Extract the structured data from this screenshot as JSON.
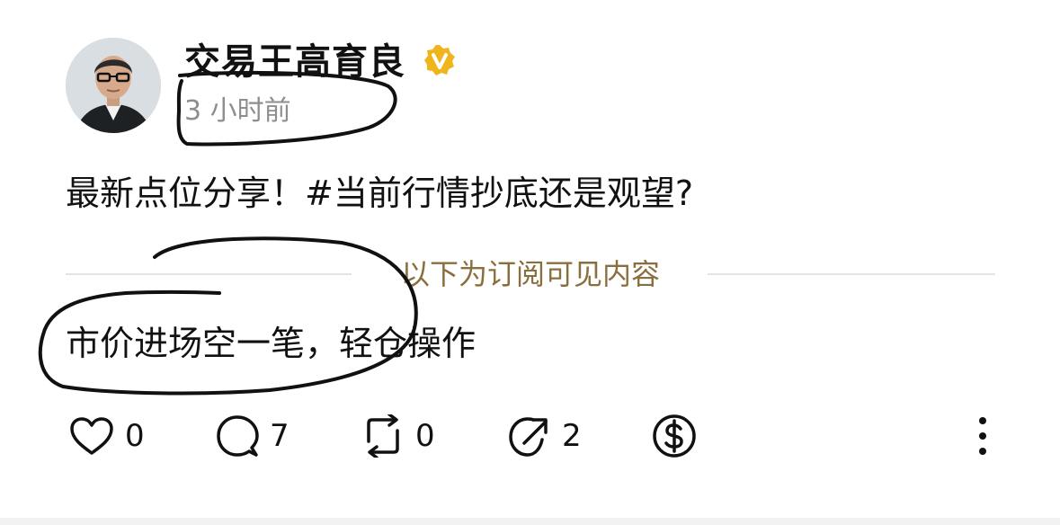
{
  "post": {
    "author": {
      "name": "交易王高育良",
      "verified": true,
      "verified_badge_color": "#f0b51d",
      "avatar_icon": "avatar-portrait"
    },
    "timestamp": "3 小时前",
    "text": "最新点位分享！#当前行情抄底还是观望?",
    "divider_label": "以下为订阅可见内容",
    "subscriber_text": "市价进场空一笔，轻仓操作",
    "colors": {
      "divider_label": "#8a6f3e",
      "timestamp": "#8e8e8e",
      "annotation_ink": "#111111"
    }
  },
  "actions": {
    "like": {
      "icon": "heart-icon",
      "count": "0"
    },
    "comment": {
      "icon": "comment-icon",
      "count": "7"
    },
    "repost": {
      "icon": "repost-icon",
      "count": "0"
    },
    "share": {
      "icon": "share-icon",
      "count": "2"
    },
    "tip": {
      "icon": "dollar-icon"
    },
    "more": {
      "icon": "more-vertical-icon"
    }
  }
}
